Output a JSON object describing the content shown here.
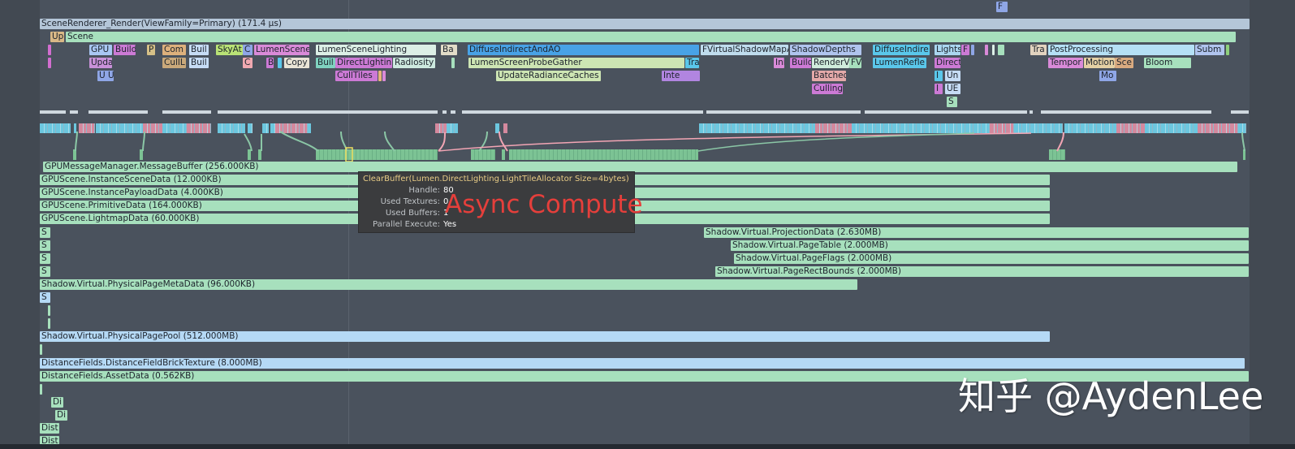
{
  "colors": {
    "background": "#4a525d",
    "async_compute_text": "#e53f3b",
    "tooltip_title": "#e8cc86",
    "tooltip_bg": "#3b3c3e"
  },
  "pass_rows": [
    [
      {
        "label": "F",
        "l": 1227,
        "w": 14,
        "c": "#8fa6e6"
      }
    ],
    [
      {
        "label": "SceneRenderer_Render(ViewFamily=Primary) (171.4 μs)",
        "l": 49,
        "w": 1490,
        "c": "#b4c6d8"
      }
    ],
    [
      {
        "label": "Up",
        "l": 62,
        "w": 17,
        "c": "#d9b886"
      },
      {
        "label": "Scene",
        "l": 81,
        "w": 1441,
        "c": "#a7e0bd"
      }
    ],
    [
      {
        "label": "",
        "l": 59,
        "w": 4,
        "c": "#d26ed0"
      },
      {
        "label": "GPU",
        "l": 110,
        "w": 28,
        "c": "#a9c7f3"
      },
      {
        "label": "Build",
        "l": 140,
        "w": 27,
        "c": "#cc7ad5"
      },
      {
        "label": "P",
        "l": 181,
        "w": 10,
        "c": "#d6c087"
      },
      {
        "label": "Com",
        "l": 200,
        "w": 29,
        "c": "#ddb07c"
      },
      {
        "label": "Buil",
        "l": 233,
        "w": 24,
        "c": "#c6dcf5"
      },
      {
        "label": "SkyAt",
        "l": 266,
        "w": 33,
        "c": "#b9e276"
      },
      {
        "label": "C",
        "l": 299,
        "w": 12,
        "c": "#8fa6e6"
      },
      {
        "label": "LumenScene",
        "l": 313,
        "w": 68,
        "c": "#d98ad8"
      },
      {
        "label": "LumenSceneLighting",
        "l": 389,
        "w": 148,
        "c": "#dcefe6"
      },
      {
        "label": "Ba",
        "l": 543,
        "w": 20,
        "c": "#e2dcc8"
      },
      {
        "label": "DiffuseIndirectAndAO",
        "l": 576,
        "w": 285,
        "c": "#48a2e6"
      },
      {
        "label": "FVirtualShadowMapA",
        "l": 863,
        "w": 108,
        "c": "#bfdced"
      },
      {
        "label": "ShadowDepths",
        "l": 973,
        "w": 88,
        "c": "#b0c4ee"
      },
      {
        "label": "DiffuseIndire",
        "l": 1075,
        "w": 70,
        "c": "#5ac7ea"
      },
      {
        "label": "Lights",
        "l": 1151,
        "w": 32,
        "c": "#aad6f0"
      },
      {
        "label": "F",
        "l": 1184,
        "w": 10,
        "c": "#cc7ad5"
      },
      {
        "label": "",
        "l": 1196,
        "w": 4,
        "c": "#8fa6e6"
      },
      {
        "label": "",
        "l": 1213,
        "w": 4,
        "c": "#d98ad8"
      },
      {
        "label": "",
        "l": 1222,
        "w": 3,
        "c": "#dcefe6"
      },
      {
        "label": "",
        "l": 1229,
        "w": 8,
        "c": "#a7e0bd"
      },
      {
        "label": "Tra",
        "l": 1269,
        "w": 20,
        "c": "#e2d3bf"
      },
      {
        "label": "PostProcessing",
        "l": 1291,
        "w": 180,
        "c": "#b5e0f5"
      },
      {
        "label": "Subm",
        "l": 1472,
        "w": 36,
        "c": "#b0c4ee"
      },
      {
        "label": "",
        "l": 1510,
        "w": 4,
        "c": "#8fd07c"
      }
    ],
    [
      {
        "label": "",
        "l": 59,
        "w": 4,
        "c": "#d26ed0"
      },
      {
        "label": "Upda",
        "l": 110,
        "w": 28,
        "c": "#c891d8"
      },
      {
        "label": "CullL",
        "l": 200,
        "w": 29,
        "c": "#c9a87a"
      },
      {
        "label": "Buil",
        "l": 233,
        "w": 24,
        "c": "#c6dcf5"
      },
      {
        "label": "C",
        "l": 299,
        "w": 12,
        "c": "#f0a8b0"
      },
      {
        "label": "B",
        "l": 328,
        "w": 9,
        "c": "#cc7ad5"
      },
      {
        "label": "",
        "l": 342,
        "w": 5,
        "c": "#5ac7ea"
      },
      {
        "label": "Copy",
        "l": 350,
        "w": 31,
        "c": "#e9e4d6"
      },
      {
        "label": "Buil",
        "l": 389,
        "w": 24,
        "c": "#7fd2bf"
      },
      {
        "label": "DirectLightin",
        "l": 413,
        "w": 70,
        "c": "#cc7ad5"
      },
      {
        "label": "Radiosity",
        "l": 484,
        "w": 52,
        "c": "#cde9df"
      },
      {
        "label": "",
        "l": 556,
        "w": 4,
        "c": "#a7e0bd"
      },
      {
        "label": "LumenScreenProbeGather",
        "l": 577,
        "w": 266,
        "c": "#cde5b3"
      },
      {
        "label": "Tra",
        "l": 844,
        "w": 17,
        "c": "#5ac7ea"
      },
      {
        "label": "Ini",
        "l": 953,
        "w": 13,
        "c": "#d98ad8"
      },
      {
        "label": "Build",
        "l": 973,
        "w": 26,
        "c": "#cc7ad5"
      },
      {
        "label": "RenderVi",
        "l": 1000,
        "w": 46,
        "c": "#d0ecdc"
      },
      {
        "label": "FV",
        "l": 1046,
        "w": 15,
        "c": "#a7e0bd"
      },
      {
        "label": "LumenRefle",
        "l": 1075,
        "w": 66,
        "c": "#5ac7ea"
      },
      {
        "label": "Direct",
        "l": 1151,
        "w": 32,
        "c": "#cc7ad5"
      },
      {
        "label": "Tempor",
        "l": 1291,
        "w": 43,
        "c": "#d98ad8"
      },
      {
        "label": "Motion",
        "l": 1335,
        "w": 38,
        "c": "#e4d0a4"
      },
      {
        "label": "Sce",
        "l": 1373,
        "w": 23,
        "c": "#d9aa80"
      },
      {
        "label": "Bloom",
        "l": 1409,
        "w": 58,
        "c": "#a7e0bd"
      }
    ],
    [
      {
        "label": "U U",
        "l": 120,
        "w": 20,
        "c": "#8fa6e6"
      },
      {
        "label": "CullTiles",
        "l": 413,
        "w": 52,
        "c": "#cc7ad5"
      },
      {
        "label": "",
        "l": 466,
        "w": 4,
        "c": "#e8b47c"
      },
      {
        "label": "",
        "l": 471,
        "w": 4,
        "c": "#d98ad8"
      },
      {
        "label": "UpdateRadianceCaches",
        "l": 611,
        "w": 129,
        "c": "#cde5b3"
      },
      {
        "label": "Inte",
        "l": 815,
        "w": 47,
        "c": "#b185e0"
      },
      {
        "label": "Batched",
        "l": 1000,
        "w": 42,
        "c": "#e4a9a9"
      },
      {
        "label": "I",
        "l": 1151,
        "w": 10,
        "c": "#5ac7ea"
      },
      {
        "label": "Un",
        "l": 1164,
        "w": 19,
        "c": "#c6dcf5"
      },
      {
        "label": "Mo",
        "l": 1354,
        "w": 21,
        "c": "#8fa6e6"
      }
    ],
    [
      {
        "label": "Culling",
        "l": 1000,
        "w": 38,
        "c": "#cc7ad5"
      },
      {
        "label": "I",
        "l": 1151,
        "w": 10,
        "c": "#cc7ad5"
      },
      {
        "label": "UE",
        "l": 1164,
        "w": 19,
        "c": "#c6dcf5"
      }
    ],
    [
      {
        "label": "S",
        "l": 1166,
        "w": 13,
        "c": "#a7e0bd"
      }
    ]
  ],
  "memory_rows": [
    [
      {
        "label": "GPUMessageManager.MessageBuffer (256.000KB)",
        "l": 53,
        "w": 1471,
        "c": "#a7e0bd"
      }
    ],
    [
      {
        "label": "GPUScene.InstanceSceneData (12.000KB)",
        "l": 49,
        "w": 1244,
        "c": "#a7e0bd"
      }
    ],
    [
      {
        "label": "GPUScene.InstancePayloadData (4.000KB)",
        "l": 49,
        "w": 1244,
        "c": "#a7e0bd"
      }
    ],
    [
      {
        "label": "GPUScene.PrimitiveData (164.000KB)",
        "l": 49,
        "w": 1244,
        "c": "#a7e0bd"
      }
    ],
    [
      {
        "label": "GPUScene.LightmapData (60.000KB)",
        "l": 49,
        "w": 1244,
        "c": "#a7e0bd"
      }
    ],
    [
      {
        "label": "S",
        "l": 49,
        "w": 13,
        "c": "#a7e0bd"
      },
      {
        "label": "Shadow.Virtual.ProjectionData (2.630MB)",
        "l": 867,
        "w": 671,
        "c": "#a7e0bd"
      }
    ],
    [
      {
        "label": "S",
        "l": 49,
        "w": 13,
        "c": "#a7e0bd"
      },
      {
        "label": "Shadow.Virtual.PageTable (2.000MB)",
        "l": 900,
        "w": 638,
        "c": "#a7e0bd"
      }
    ],
    [
      {
        "label": "S",
        "l": 49,
        "w": 13,
        "c": "#a7e0bd"
      },
      {
        "label": "Shadow.Virtual.PageFlags (2.000MB)",
        "l": 904,
        "w": 634,
        "c": "#a7e0bd"
      }
    ],
    [
      {
        "label": "S",
        "l": 49,
        "w": 13,
        "c": "#a7e0bd"
      },
      {
        "label": "Shadow.Virtual.PageRectBounds (2.000MB)",
        "l": 881,
        "w": 657,
        "c": "#a7e0bd"
      }
    ],
    [
      {
        "label": "Shadow.Virtual.PhysicalPageMetaData (96.000KB)",
        "l": 49,
        "w": 1007,
        "c": "#a7e0bd"
      }
    ],
    [
      {
        "label": "S",
        "l": 49,
        "w": 13,
        "c": "#b5d9f5"
      }
    ],
    [
      {
        "label": "",
        "l": 59,
        "w": 3,
        "c": "#a7e0bd"
      }
    ],
    [
      {
        "label": "",
        "l": 59,
        "w": 3,
        "c": "#a7e0bd"
      }
    ],
    [
      {
        "label": "Shadow.Virtual.PhysicalPagePool (512.000MB)",
        "l": 49,
        "w": 1244,
        "c": "#b5d9f5"
      }
    ],
    [
      {
        "label": "",
        "l": 49,
        "w": 3,
        "c": "#a7e0bd"
      }
    ],
    [
      {
        "label": "DistanceFields.DistanceFieldBrickTexture (8.000MB)",
        "l": 49,
        "w": 1484,
        "c": "#b5d9f5"
      }
    ],
    [
      {
        "label": "DistanceFields.AssetData (0.562KB)",
        "l": 49,
        "w": 1489,
        "c": "#a7e0bd"
      }
    ],
    [
      {
        "label": "",
        "l": 49,
        "w": 3,
        "c": "#a7e0bd"
      }
    ],
    [
      {
        "label": "Di",
        "l": 63,
        "w": 15,
        "c": "#a7e0bd"
      }
    ],
    [
      {
        "label": "Di",
        "l": 68,
        "w": 15,
        "c": "#a7e0bd"
      }
    ],
    [
      {
        "label": "Dist",
        "l": 49,
        "w": 24,
        "c": "#a7e0bd"
      }
    ],
    [
      {
        "label": "Dist",
        "l": 49,
        "w": 24,
        "c": "#a7e0bd"
      }
    ]
  ],
  "ticks": [
    [
      49,
      32
    ],
    [
      86,
      10
    ],
    [
      109,
      73
    ],
    [
      200,
      60
    ],
    [
      268,
      271
    ],
    [
      545,
      5
    ],
    [
      555,
      6
    ],
    [
      569,
      297
    ],
    [
      870,
      190
    ],
    [
      1065,
      200
    ],
    [
      1268,
      4
    ],
    [
      1282,
      210
    ],
    [
      1516,
      22
    ]
  ],
  "strip_blocks": [
    [
      49,
      38,
      "c"
    ],
    [
      91,
      3,
      "c"
    ],
    [
      97,
      20,
      "p"
    ],
    [
      118,
      58,
      "c"
    ],
    [
      176,
      24,
      "p"
    ],
    [
      200,
      30,
      "c"
    ],
    [
      230,
      30,
      "p"
    ],
    [
      268,
      34,
      "c"
    ],
    [
      305,
      6,
      "c"
    ],
    [
      323,
      8,
      "c"
    ],
    [
      333,
      6,
      "c"
    ],
    [
      339,
      40,
      "p"
    ],
    [
      379,
      4,
      "c"
    ],
    [
      536,
      14,
      "p"
    ],
    [
      550,
      14,
      "c"
    ],
    [
      610,
      5,
      "c"
    ],
    [
      620,
      5,
      "p"
    ],
    [
      861,
      143,
      "c"
    ],
    [
      1004,
      45,
      "p"
    ],
    [
      1049,
      170,
      "c"
    ],
    [
      1219,
      30,
      "p"
    ],
    [
      1249,
      60,
      "c"
    ],
    [
      1311,
      64,
      "c"
    ],
    [
      1375,
      35,
      "p"
    ],
    [
      1410,
      65,
      "c"
    ],
    [
      1475,
      50,
      "p"
    ],
    [
      1525,
      10,
      "c"
    ]
  ],
  "lanes": [
    [
      90,
      4
    ],
    [
      172,
      4
    ],
    [
      305,
      4
    ],
    [
      318,
      4
    ],
    [
      389,
      150
    ],
    [
      580,
      30
    ],
    [
      618,
      4
    ],
    [
      627,
      233
    ],
    [
      1292,
      20
    ],
    [
      1531,
      3
    ]
  ],
  "tooltip": {
    "title": "ClearBuffer(Lumen.DirectLighting.LightTileAllocator Size=4bytes)",
    "rows": [
      {
        "key": "Handle:",
        "value": "80"
      },
      {
        "key": "Used Textures:",
        "value": "0"
      },
      {
        "key": "Used Buffers:",
        "value": "1"
      },
      {
        "key": "Parallel Execute:",
        "value": "Yes"
      }
    ],
    "annotation": "Async Compute"
  },
  "watermark": "知乎 @AydenLee"
}
